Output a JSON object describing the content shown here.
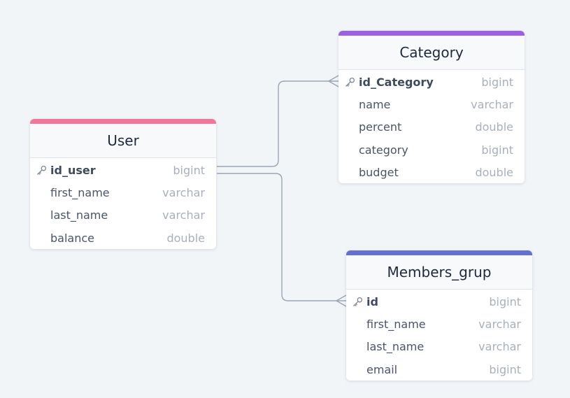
{
  "colors": {
    "background": "#f1f5f8",
    "connector": "#9aa5b4",
    "user_accent": "#f2759a",
    "category_accent": "#9b5fe0",
    "members_accent": "#6370cf"
  },
  "tables": {
    "user": {
      "title": "User",
      "columns": [
        {
          "name": "id_user",
          "type": "bigint",
          "primary_key": true
        },
        {
          "name": "first_name",
          "type": "varchar"
        },
        {
          "name": "last_name",
          "type": "varchar"
        },
        {
          "name": "balance",
          "type": "double"
        }
      ]
    },
    "category": {
      "title": "Category",
      "columns": [
        {
          "name": "id_Category",
          "type": "bigint",
          "primary_key": true
        },
        {
          "name": "name",
          "type": "varchar"
        },
        {
          "name": "percent",
          "type": "double"
        },
        {
          "name": "category",
          "type": "bigint"
        },
        {
          "name": "budget",
          "type": "double"
        }
      ]
    },
    "members_grup": {
      "title": "Members_grup",
      "columns": [
        {
          "name": "id",
          "type": "bigint",
          "primary_key": true
        },
        {
          "name": "first_name",
          "type": "varchar"
        },
        {
          "name": "last_name",
          "type": "varchar"
        },
        {
          "name": "email",
          "type": "bigint"
        }
      ]
    }
  },
  "relationships": [
    {
      "from": "User.id_user",
      "to": "Category.id_Category",
      "cardinality": "one-to-many"
    },
    {
      "from": "User.id_user",
      "to": "Members_grup.id",
      "cardinality": "one-to-many"
    }
  ]
}
